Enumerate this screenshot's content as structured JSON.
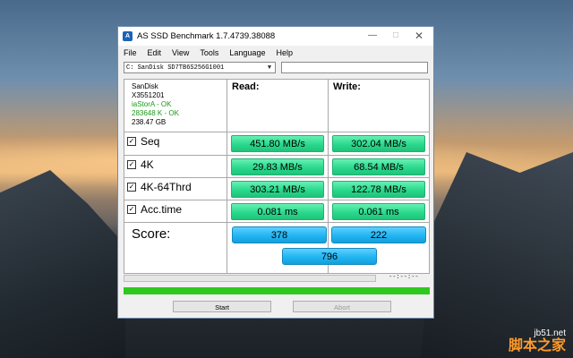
{
  "window": {
    "title": "AS SSD Benchmark 1.7.4739.38088",
    "controls": {
      "minimize": "—",
      "maximize": "□",
      "close": "✕"
    },
    "app_icon": "A"
  },
  "menu": [
    "File",
    "Edit",
    "View",
    "Tools",
    "Language",
    "Help"
  ],
  "drive": {
    "selected": "C: SanDisk SD7TB6S256G1001",
    "box_value": ""
  },
  "info": {
    "model": "SanDisk",
    "firmware": "X3551201",
    "driver": "iaStorA - OK",
    "alignment": "283648 K - OK",
    "capacity": "238.47 GB"
  },
  "headers": {
    "read": "Read:",
    "write": "Write:"
  },
  "rows": [
    {
      "label": "Seq",
      "read": "451.80 MB/s",
      "write": "302.04 MB/s"
    },
    {
      "label": "4K",
      "read": "29.83 MB/s",
      "write": "68.54 MB/s"
    },
    {
      "label": "4K-64Thrd",
      "read": "303.21 MB/s",
      "write": "122.78 MB/s"
    },
    {
      "label": "Acc.time",
      "read": "0.081 ms",
      "write": "0.061 ms"
    }
  ],
  "score": {
    "label": "Score:",
    "read": "378",
    "write": "222",
    "total": "796"
  },
  "time_display": "--:--:--",
  "progress": {
    "value": 1.0,
    "color": "#2ec81e"
  },
  "buttons": {
    "start": "Start",
    "abort": "Abort"
  },
  "watermark": {
    "site": "jb51.net",
    "name": "脚本之家"
  },
  "colors": {
    "value_green": "#2ad98c",
    "score_blue": "#21b5f2"
  }
}
